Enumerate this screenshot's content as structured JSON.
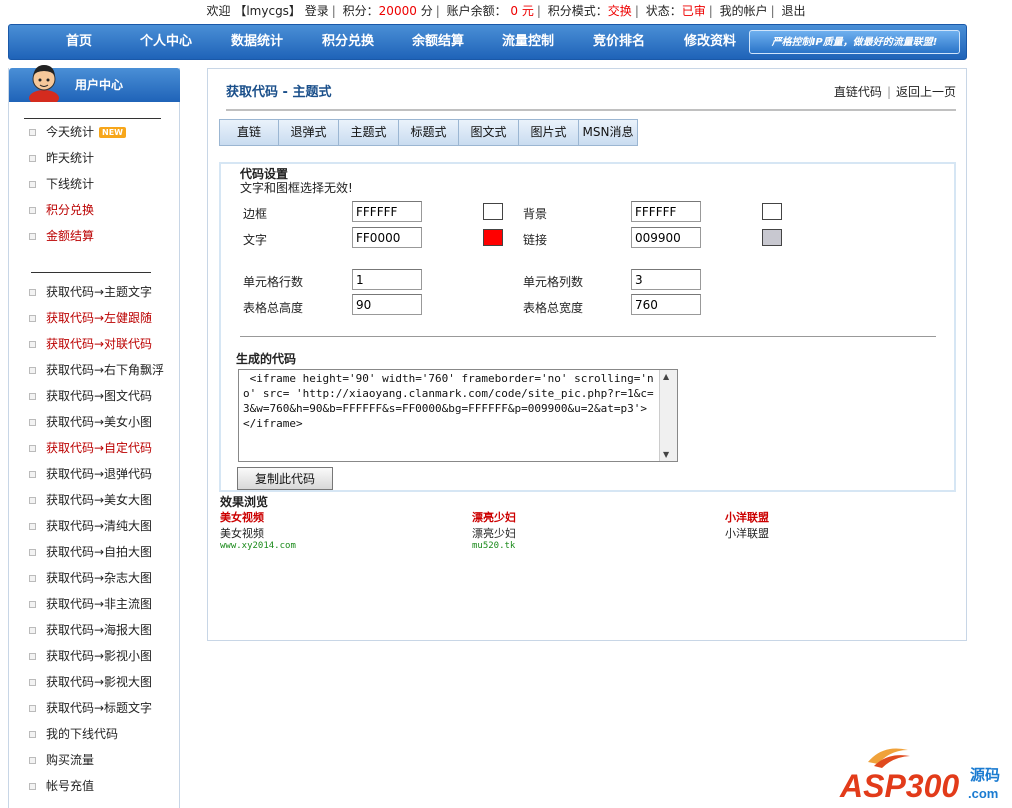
{
  "topbar": {
    "welcome": "欢迎",
    "username": "【lmycgs】",
    "login": "登录",
    "points_label": "积分：",
    "points_value": "20000",
    "points_unit": "分",
    "balance_label": "账户余额：",
    "balance_value": "0",
    "balance_unit": "元",
    "mode_label": "积分模式：",
    "mode_value": "交换",
    "status_label": "状态：",
    "status_value": "已审",
    "my_account": "我的帐户",
    "logout": "退出"
  },
  "nav": {
    "items": [
      "首页",
      "个人中心",
      "数据统计",
      "积分兑换",
      "余额结算",
      "流量控制",
      "竞价排名",
      "修改资料"
    ],
    "slogan": "严格控制IP质量，做最好的流量联盟!"
  },
  "sidebar": {
    "title": "用户中心",
    "badge_new": "NEW",
    "group1": [
      {
        "label": "今天统计",
        "color": "normal"
      },
      {
        "label": "昨天统计",
        "color": "normal"
      },
      {
        "label": "下线统计",
        "color": "normal"
      },
      {
        "label": "积分兑换",
        "color": "red"
      },
      {
        "label": "金额结算",
        "color": "red"
      }
    ],
    "group2": [
      {
        "label": "获取代码→主题文字",
        "color": "normal"
      },
      {
        "label": "获取代码→左健跟随",
        "color": "red"
      },
      {
        "label": "获取代码→对联代码",
        "color": "red"
      },
      {
        "label": "获取代码→右下角飘浮",
        "color": "normal"
      },
      {
        "label": "获取代码→图文代码",
        "color": "normal"
      },
      {
        "label": "获取代码→美女小图",
        "color": "normal"
      },
      {
        "label": "获取代码→自定代码",
        "color": "red"
      },
      {
        "label": "获取代码→退弹代码",
        "color": "normal"
      },
      {
        "label": "获取代码→美女大图",
        "color": "normal"
      },
      {
        "label": "获取代码→清纯大图",
        "color": "normal"
      },
      {
        "label": "获取代码→自拍大图",
        "color": "normal"
      },
      {
        "label": "获取代码→杂志大图",
        "color": "normal"
      },
      {
        "label": "获取代码→非主流图",
        "color": "normal"
      },
      {
        "label": "获取代码→海报大图",
        "color": "normal"
      },
      {
        "label": "获取代码→影视小图",
        "color": "normal"
      },
      {
        "label": "获取代码→影视大图",
        "color": "normal"
      },
      {
        "label": "获取代码→标题文字",
        "color": "normal"
      },
      {
        "label": "我的下线代码",
        "color": "normal"
      },
      {
        "label": "购买流量",
        "color": "normal"
      },
      {
        "label": "帐号充值",
        "color": "normal"
      }
    ]
  },
  "main": {
    "title": "获取代码  - 主题式",
    "link_direct": "直链代码",
    "link_back": "返回上一页",
    "tabs": [
      "直链",
      "退弹式",
      "主题式",
      "标题式",
      "图文式",
      "图片式",
      "MSN消息"
    ],
    "settings": {
      "heading": "代码设置",
      "note": "文字和图框选择无效!",
      "border_label": "边框",
      "border_value": "FFFFFF",
      "border_color": "#FFFFFF",
      "bg_label": "背景",
      "bg_value": "FFFFFF",
      "bg_color": "#FFFFFF",
      "text_label": "文字",
      "text_value": "FF0000",
      "text_color": "#FF0000",
      "link_label": "链接",
      "link_value": "009900",
      "link_color": "#C8C8D0",
      "rows_label": "单元格行数",
      "rows_value": "1",
      "cols_label": "单元格列数",
      "cols_value": "3",
      "height_label": "表格总高度",
      "height_value": "90",
      "width_label": "表格总宽度",
      "width_value": "760"
    },
    "generated": {
      "heading": "生成的代码",
      "code": " <iframe height='90' width='760' frameborder='no' scrolling='no' src= 'http://xiaoyang.clanmark.com/code/site_pic.php?r=1&c=3&w=760&h=90&b=FFFFFF&s=FF0000&bg=FFFFFF&p=009900&u=2&at=p3'></iframe>",
      "copy_button": "复制此代码"
    },
    "preview": {
      "heading": "效果浏览",
      "items": [
        {
          "title": "美女视频",
          "text": "美女视频",
          "url": "www.xy2014.com"
        },
        {
          "title": "漂亮少妇",
          "text": "漂亮少妇",
          "url": "mu520.tk"
        },
        {
          "title": "小洋联盟",
          "text": "小洋联盟",
          "url": ""
        }
      ]
    }
  },
  "watermark": {
    "brand": "ASP300",
    "suffix": "源码",
    "domain": ".com"
  }
}
